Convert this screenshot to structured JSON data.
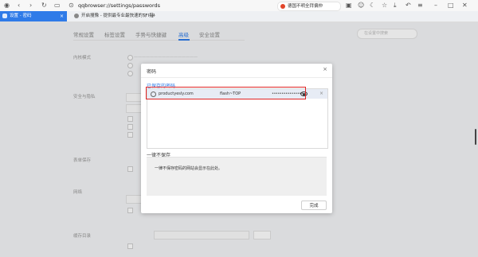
{
  "browser": {
    "url": "qqbrowser://settings/passwords",
    "search_pill_text": "德国不明全拜偏仲"
  },
  "tabs": [
    {
      "label": "设置 - 密码",
      "active": true
    },
    {
      "label": "开启搜豫 - 提供最专业最快速的TFI指!"
    }
  ],
  "settings": {
    "nav": [
      "常规设置",
      "标签设置",
      "手势与快捷键",
      "高级",
      "安全设置"
    ],
    "active_nav_index": 3,
    "search_placeholder": "在设置中搜索",
    "sections": [
      "内核模式",
      "安全与隐私",
      "表单保存",
      "网络",
      "缓存目录"
    ]
  },
  "dialog": {
    "title": "密码",
    "close": "×",
    "saved_heading": "已保存的密码",
    "saved_passwords": [
      {
        "site": "productyesly.com",
        "username": "flash~TOP",
        "password_mask": "••••••••••••••••"
      }
    ],
    "never_heading": "一律不保存",
    "never_empty_text": "一律不保存密码的网站会显示在此处。",
    "done_label": "完成"
  },
  "colors": {
    "accent": "#2f7be8",
    "highlight": "#e02424"
  }
}
